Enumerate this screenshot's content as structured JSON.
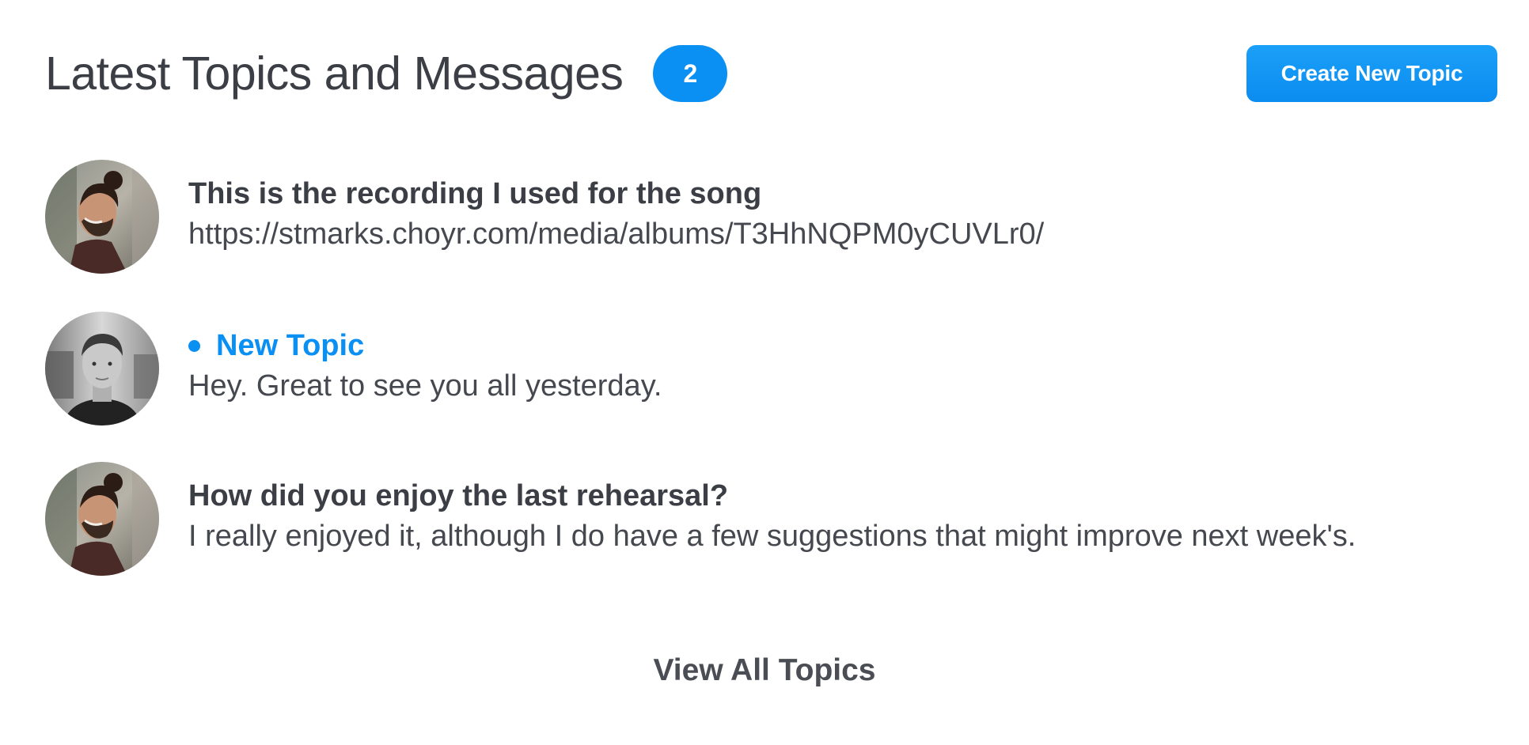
{
  "header": {
    "title": "Latest Topics and Messages",
    "count": "2",
    "create_label": "Create New Topic"
  },
  "topics": [
    {
      "title": "This is the recording I used for the song",
      "message": "https://stmarks.choyr.com/media/albums/T3HhNQPM0yCUVLr0/",
      "unread": false,
      "avatar": "man-with-bun-avatar"
    },
    {
      "title": "New Topic",
      "message": "Hey. Great to see you all yesterday.",
      "unread": true,
      "avatar": "man-portrait-bw-avatar"
    },
    {
      "title": "How did you enjoy the last rehearsal?",
      "message": "I really enjoyed it, although I do have a few suggestions that might improve next week's.",
      "unread": false,
      "avatar": "man-with-bun-avatar"
    }
  ],
  "footer": {
    "view_all_label": "View All Topics"
  },
  "colors": {
    "accent": "#0a8ff2",
    "text": "#3b3e45"
  }
}
